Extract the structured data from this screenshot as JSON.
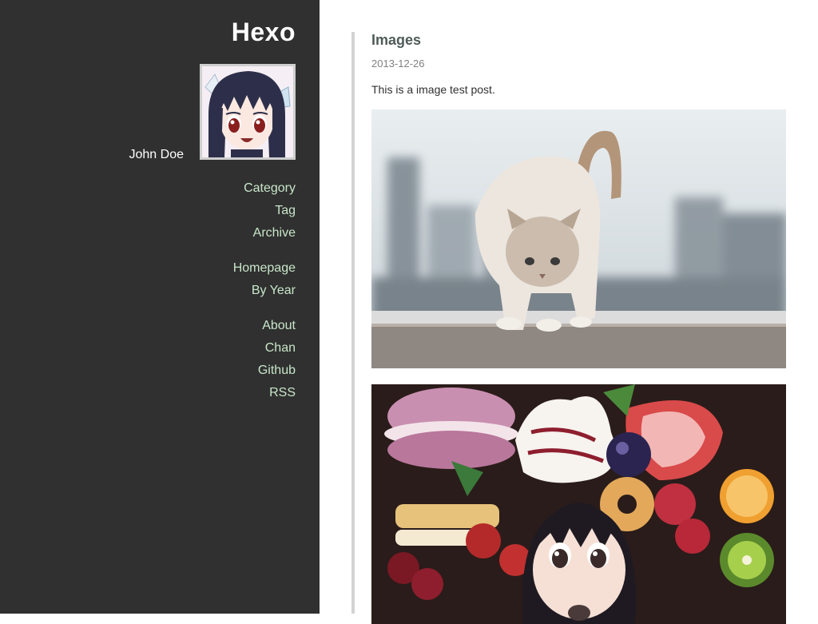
{
  "sidebar": {
    "site_title": "Hexo",
    "author": "John Doe",
    "nav_groups": [
      {
        "items": [
          "Category",
          "Tag",
          "Archive"
        ]
      },
      {
        "items": [
          "Homepage",
          "By Year"
        ]
      },
      {
        "items": [
          "About",
          "Chan",
          "Github",
          "RSS"
        ]
      }
    ],
    "colors": {
      "background": "#303030",
      "link": "#c8e6c9"
    }
  },
  "post": {
    "title": "Images",
    "date": "2013-12-26",
    "text": "This is a image test post."
  },
  "icons": {
    "avatar": "anime-girl-avatar"
  }
}
